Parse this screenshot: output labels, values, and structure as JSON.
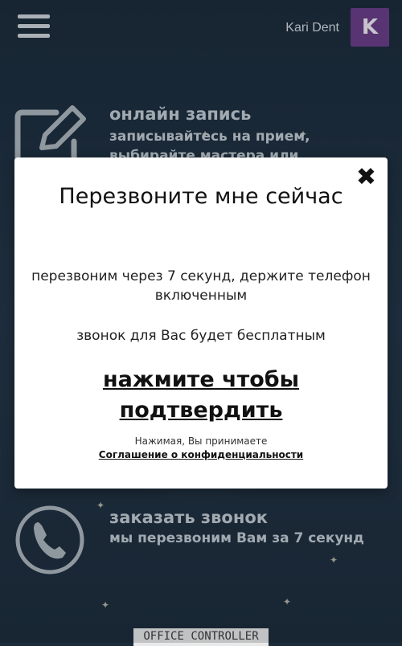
{
  "header": {
    "user_name": "Kari Dent",
    "avatar_letter": "K"
  },
  "features": [
    {
      "title": "онлайн запись",
      "subtitle": "записывайтесь на прием,",
      "subtitle_cut": "выбирайте мастера или",
      "icon": "edit-icon"
    },
    {
      "title": "заказать звонок",
      "subtitle": "мы перезвоним Вам за 7 секунд",
      "icon": "phone-icon"
    }
  ],
  "footer": {
    "logo_text": "OFFICE CONTROLLER"
  },
  "modal": {
    "close_symbol": "✖",
    "title": "Перезвоните мне сейчас",
    "text1": "перезвоним через 7 секунд, держите телефон включенным",
    "text2": "звонок для Вас будет бесплатным",
    "cta": "нажмите чтобы подтвердить",
    "note": "Нажимая, Вы принимаете",
    "privacy_link": "Соглашение о конфиденциальности"
  },
  "colors": {
    "background": "#1c2b3a",
    "avatar": "#6a3c88",
    "modal_bg": "#ffffff",
    "text_on_dark": "#c4ccd4"
  }
}
